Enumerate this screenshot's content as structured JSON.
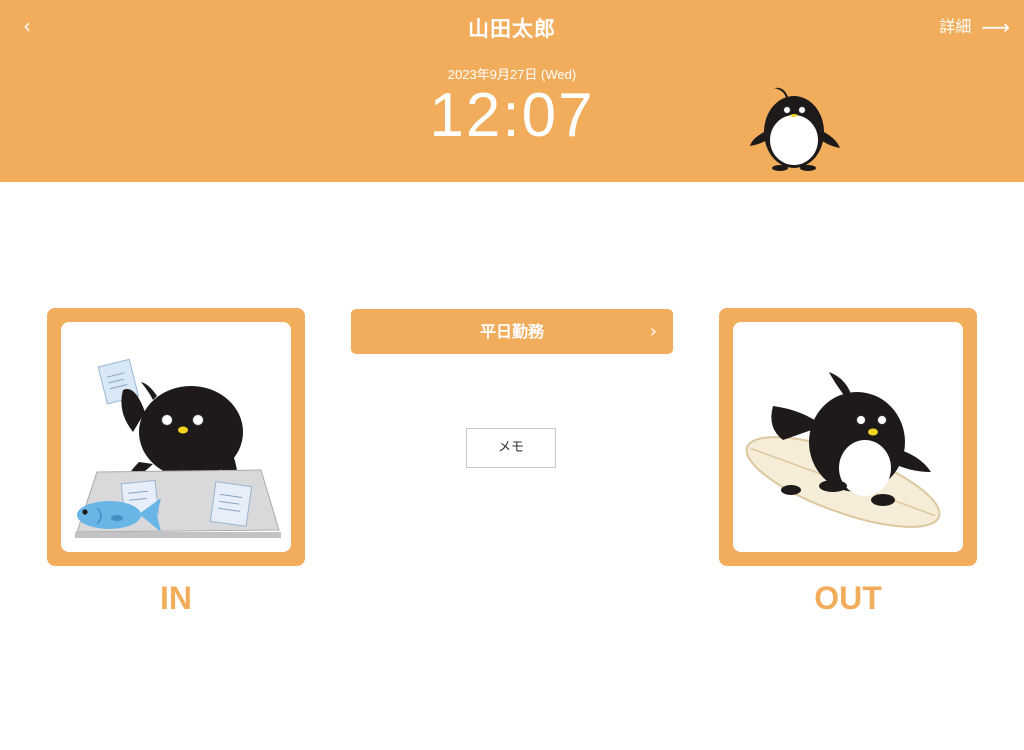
{
  "header": {
    "back_icon": "chevron-left-icon",
    "back_glyph": "‹",
    "title": "山田太郎",
    "detail_label": "詳細",
    "detail_icon": "arrow-right-icon",
    "detail_glyph": "⟶",
    "date": "2023年9月27日 (Wed)",
    "time": "12:07",
    "mascot": "penguin-icon"
  },
  "shift": {
    "label": "平日勤務",
    "chevron_glyph": "›"
  },
  "memo": {
    "label": "メモ"
  },
  "clock_in": {
    "label": "IN",
    "illustration": "penguin-working-with-fish"
  },
  "clock_out": {
    "label": "OUT",
    "illustration": "penguin-surfing"
  },
  "colors": {
    "accent": "#f2ad5c",
    "text_on_accent": "#ffffff",
    "penguin_body": "#1e1a1a",
    "penguin_beak": "#f4d321",
    "fish": "#69b6e6",
    "surfboard": "#f6edd8"
  }
}
